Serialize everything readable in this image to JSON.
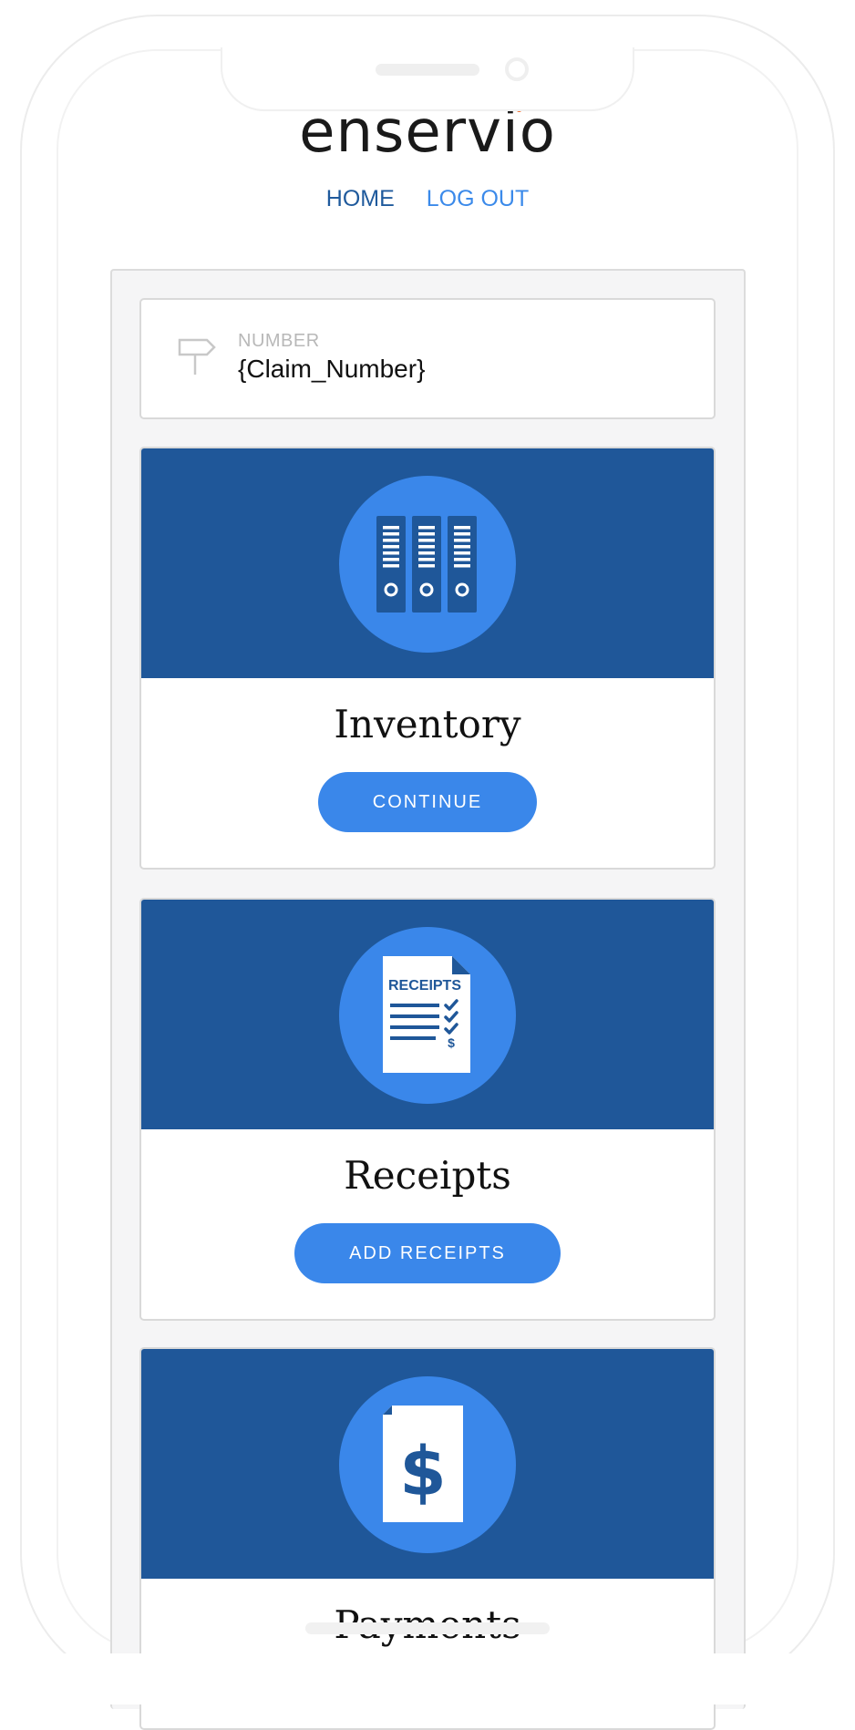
{
  "app": {
    "logo_text": "enservio"
  },
  "nav": {
    "home_label": "HOME",
    "logout_label": "LOG OUT"
  },
  "claim": {
    "label": "NUMBER",
    "value": "{Claim_Number}",
    "icon": "signpost-icon"
  },
  "cards": [
    {
      "title": "Inventory",
      "button_label": "CONTINUE",
      "icon": "binders-icon"
    },
    {
      "title": "Receipts",
      "button_label": "ADD RECEIPTS",
      "icon": "receipts-document-icon",
      "icon_text": "RECEIPTS",
      "icon_currency": "$"
    },
    {
      "title": "Payments",
      "icon": "payment-document-icon",
      "icon_currency": "$"
    }
  ],
  "colors": {
    "brand_dark_blue": "#1f5799",
    "accent_blue": "#3a87ea",
    "logo_dot": "#f26522"
  }
}
